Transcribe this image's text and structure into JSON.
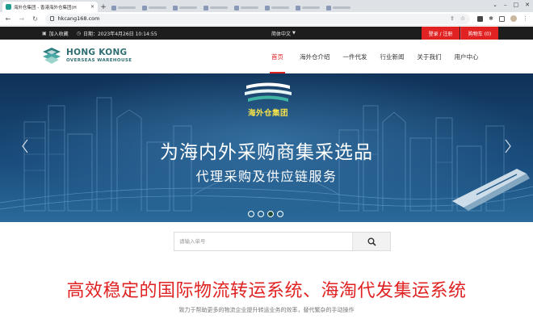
{
  "browser": {
    "tab_title": "海外仓集团 - 香港海外仓集团(H",
    "tab_close": "✕",
    "new_tab": "+",
    "url": "hkcang168.com",
    "colors": {
      "favicon": "#1e9c8e"
    }
  },
  "topbar": {
    "bookmark": "加入收藏",
    "date": "日期：2023年4月26日 10:14:55",
    "language": "简体中文",
    "login": "登录 / 注册",
    "cart": "购物车 (0)",
    "colors": {
      "bg": "#1d1d1d",
      "accent": "#e02222"
    }
  },
  "header": {
    "logo_main": "HONG KONG",
    "logo_sub": "OVERSEAS WAREHOUSE",
    "nav": [
      "首页",
      "海外仓介绍",
      "一件代发",
      "行业新闻",
      "关于我们",
      "用户中心"
    ],
    "active_nav": "首页"
  },
  "hero": {
    "logo_text": "海外仓集团",
    "title": "为海内外采购商集采选品",
    "subtitle": "代理采购及供应链服务",
    "slide_count": 4,
    "active_slide": 3
  },
  "search": {
    "placeholder": "请输入单号",
    "button_icon": "search-icon"
  },
  "section": {
    "title": "高效稳定的国际物流转运系统、海淘代发集运系统",
    "subtitle": "致力于帮助更多的物流企业提升转运业务的效率，替代繁杂的手动操作"
  }
}
